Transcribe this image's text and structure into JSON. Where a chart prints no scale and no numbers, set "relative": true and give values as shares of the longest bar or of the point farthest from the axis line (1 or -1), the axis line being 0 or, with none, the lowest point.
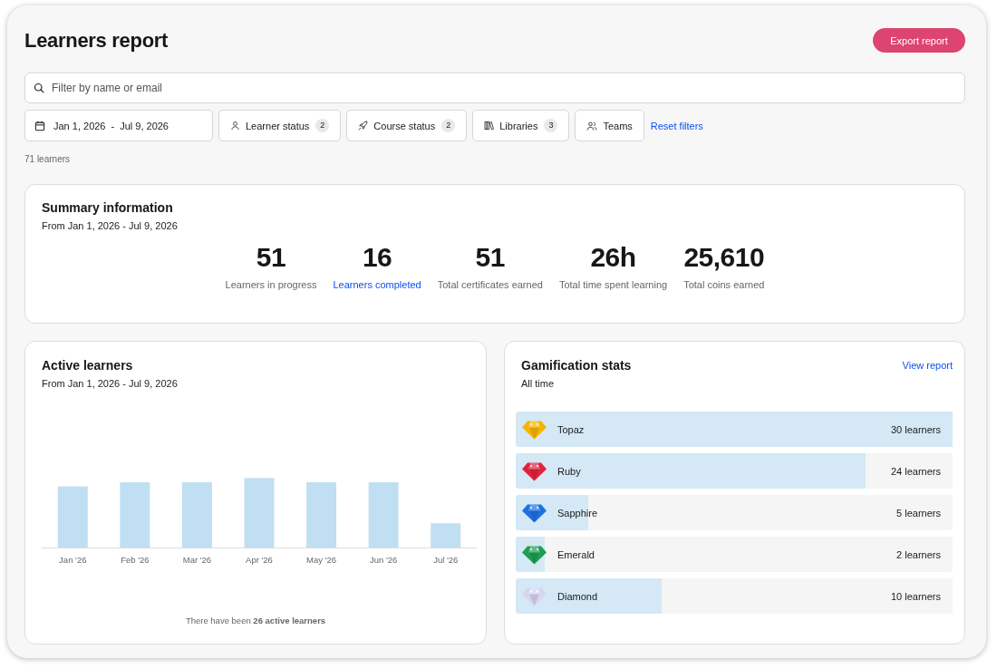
{
  "page": {
    "title": "Learners report",
    "export_button": "Export report"
  },
  "search": {
    "placeholder": "Filter by name or email"
  },
  "filters": {
    "date_range": {
      "start": "Jan 1, 2026",
      "separator": "-",
      "end": "Jul 9, 2026"
    },
    "chips": [
      {
        "kind": "learner",
        "label": "Learner status",
        "count": "2"
      },
      {
        "kind": "course",
        "label": "Course status",
        "count": "2"
      },
      {
        "kind": "library",
        "label": "Libraries",
        "count": "3"
      },
      {
        "kind": "team",
        "label": "Teams"
      }
    ],
    "reset_link": "Reset filters"
  },
  "result_count": "71 learners",
  "summary": {
    "title": "Summary information",
    "subtitle": "From Jan 1, 2026 - Jul 9, 2026",
    "stats": [
      {
        "value": "51",
        "label": "Learners in progress",
        "link": false
      },
      {
        "value": "16",
        "label": "Learners completed",
        "link": true
      },
      {
        "value": "51",
        "label": "Total certificates earned",
        "link": false
      },
      {
        "value": "26h",
        "label": "Total time spent learning",
        "link": false
      },
      {
        "value": "25,610",
        "label": "Total coins earned",
        "link": false
      }
    ]
  },
  "active_learners": {
    "title": "Active learners",
    "subtitle": "From Jan 1, 2026 - Jul 9, 2026",
    "chart_data": {
      "type": "bar",
      "relative": true,
      "categories": [
        "Jan '26",
        "Feb '26",
        "Mar '26",
        "Apr '26",
        "May '26",
        "Jun '26",
        "Jul '26"
      ],
      "values": [
        0.88,
        0.94,
        0.94,
        1.0,
        0.94,
        0.94,
        0.35
      ]
    },
    "footer": "There have been **26 active learners**"
  },
  "gamification": {
    "title": "Gamification stats",
    "link": "View report",
    "subtitle": "All time",
    "gems": [
      {
        "name": "Topaz",
        "count": "30 learners",
        "level": 1.0,
        "color": "#f6b400"
      },
      {
        "name": "Ruby",
        "count": "24 learners",
        "level": 0.8,
        "color": "#e0213d"
      },
      {
        "name": "Sapphire",
        "count": "5 learners",
        "level": 0.167,
        "color": "#1f6fe3"
      },
      {
        "name": "Emerald",
        "count": "2 learners",
        "level": 0.067,
        "color": "#1f9d52"
      },
      {
        "name": "Diamond",
        "count": "10 learners",
        "level": 0.333,
        "color": "#d8d4f2"
      }
    ]
  }
}
